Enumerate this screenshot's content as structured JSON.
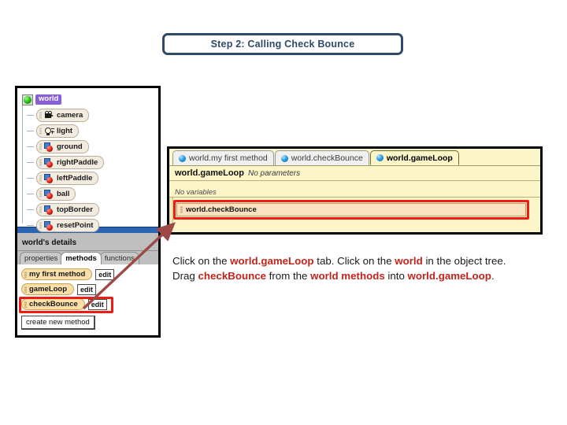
{
  "banner": {
    "title": "Step 2: Calling Check Bounce"
  },
  "object_tree": {
    "root": {
      "label": "world",
      "icon": "green-sphere-icon",
      "selected": true
    },
    "items": [
      {
        "label": "camera",
        "icon": "camera-icon"
      },
      {
        "label": "light",
        "icon": "light-icon"
      },
      {
        "label": "ground",
        "icon": "object-icon"
      },
      {
        "label": "rightPaddle",
        "icon": "object-icon"
      },
      {
        "label": "leftPaddle",
        "icon": "object-icon"
      },
      {
        "label": "ball",
        "icon": "object-icon"
      },
      {
        "label": "topBorder",
        "icon": "object-icon"
      },
      {
        "label": "resetPoint",
        "icon": "object-icon"
      }
    ]
  },
  "details_panel": {
    "title": "world's details",
    "tabs": [
      {
        "label": "properties",
        "active": false
      },
      {
        "label": "methods",
        "active": true
      },
      {
        "label": "functions",
        "active": false
      }
    ],
    "methods": [
      {
        "label": "my first method",
        "edit_label": "edit",
        "highlighted": false
      },
      {
        "label": "gameLoop",
        "edit_label": "edit",
        "highlighted": false
      },
      {
        "label": "checkBounce",
        "edit_label": "edit",
        "highlighted": true
      }
    ],
    "create_button": "create new method"
  },
  "editor_panel": {
    "tabs": [
      {
        "label": "world.my first method",
        "active": false
      },
      {
        "label": "world.checkBounce",
        "active": false
      },
      {
        "label": "world.gameLoop",
        "active": true
      }
    ],
    "signature_name": "world.gameLoop",
    "signature_params": "No parameters",
    "variables": "No variables",
    "statements": [
      {
        "label": "world.checkBounce",
        "highlighted": true
      }
    ]
  },
  "instructions": {
    "seg1": "Click on the ",
    "hl1": "world.gameLoop",
    "seg2": " tab. Click on the ",
    "hl2": "world",
    "seg3": " in the object tree. Drag ",
    "hl3": "checkBounce",
    "seg4": " from the ",
    "hl4": "world methods",
    "seg5": " into ",
    "hl5": "world.gameLoop",
    "seg6": "."
  },
  "colors": {
    "banner_border": "#2e4a68",
    "highlight_red": "#ee1c14",
    "instruction_red": "#c0241c",
    "editor_bg": "#fbf5c8",
    "arrow": "#9d4a46",
    "selected_purple": "#8a5fd6",
    "titlebar_blue": "#2b64b0"
  }
}
